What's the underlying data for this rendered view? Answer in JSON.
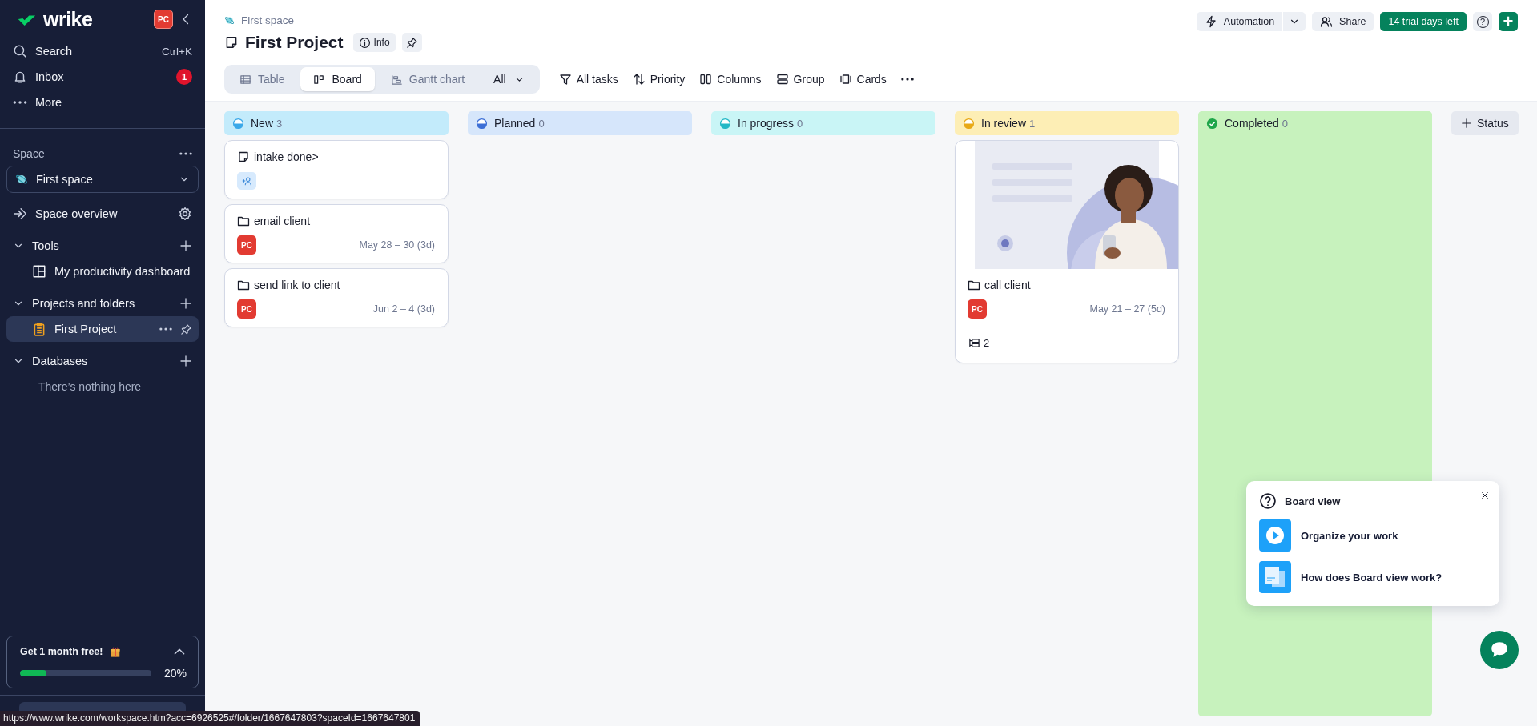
{
  "sidebar": {
    "logo": "wrike",
    "avatar": "PC",
    "nav": [
      {
        "label": "Search",
        "kind": "search",
        "shortcut": "Ctrl+K"
      },
      {
        "label": "Inbox",
        "kind": "inbox",
        "badge": "1"
      },
      {
        "label": "More",
        "kind": "more"
      }
    ],
    "space_label": "Space",
    "space_selector": "First space",
    "space_overview": "Space overview",
    "sections": [
      {
        "label": "Tools",
        "expanded": true,
        "items": [
          {
            "label": "My productivity dashboard",
            "kind": "dashboard",
            "selected": false
          }
        ]
      },
      {
        "label": "Projects and folders",
        "expanded": true,
        "items": [
          {
            "label": "First Project",
            "kind": "project",
            "selected": true
          }
        ]
      },
      {
        "label": "Databases",
        "expanded": true,
        "empty_text": "There’s nothing here"
      }
    ],
    "promo": {
      "title": "Get 1 month free!",
      "level": 0.2,
      "reading": "20%",
      "expanded": true
    }
  },
  "header": {
    "breadcrumb": "First space",
    "title": "First Project",
    "info_button": "Info",
    "actions": [
      {
        "label": "Automation",
        "kind": "automation"
      },
      {
        "label": "Share",
        "kind": "share"
      },
      {
        "label": "14 trial days left",
        "kind": "trial"
      },
      {
        "label": "?",
        "kind": "help"
      },
      {
        "label": "+",
        "kind": "add"
      }
    ],
    "view_tabs": [
      {
        "label": "Table",
        "kind": "table",
        "selected": false
      },
      {
        "label": "Board",
        "kind": "board",
        "selected": true
      },
      {
        "label": "Gantt chart",
        "kind": "gantt",
        "selected": false
      },
      {
        "label": "All",
        "kind": "dropdown",
        "selected": false
      }
    ],
    "tools": [
      {
        "label": "All tasks",
        "kind": "filter"
      },
      {
        "label": "Priority",
        "kind": "sort"
      },
      {
        "label": "Columns",
        "kind": "columns"
      },
      {
        "label": "Group",
        "kind": "group"
      },
      {
        "label": "Cards",
        "kind": "cards"
      },
      {
        "kind": "more"
      }
    ]
  },
  "board": {
    "columns": [
      {
        "name": "New",
        "count": "3",
        "kind": "open",
        "color": "#c3ebfb",
        "cards": [
          {
            "title": "intake done>",
            "kind": "note"
          },
          {
            "title": "email client",
            "kind": "folder",
            "assignee": "PC",
            "dates": "May 28 – 30 (3d)"
          },
          {
            "title": "send link to client",
            "kind": "folder",
            "assignee": "PC",
            "dates": "Jun 2 – 4 (3d)"
          }
        ]
      },
      {
        "name": "Planned",
        "count": "0",
        "kind": "open",
        "color": "#d6e6fb"
      },
      {
        "name": "In progress",
        "count": "0",
        "kind": "open",
        "color": "#c9f5f6"
      },
      {
        "name": "In review",
        "count": "1",
        "kind": "open",
        "color": "#fdeeb5",
        "cards": [
          {
            "title": "call client",
            "kind": "folder",
            "assignee": "PC",
            "dates": "May 21 – 27 (5d)",
            "subtasks": "2"
          }
        ]
      },
      {
        "name": "Completed",
        "count": "0",
        "kind": "completed",
        "color": "#c7f2bd"
      }
    ],
    "add_status": "Status"
  },
  "popup": {
    "title": "Board view",
    "items": [
      {
        "label": "Organize your work",
        "kind": "video"
      },
      {
        "label": "How does Board view work?",
        "kind": "doc"
      }
    ]
  },
  "status_url": "https://www.wrike.com/workspace.htm?acc=6926525#/folder/1667647803?spaceId=1667647801"
}
